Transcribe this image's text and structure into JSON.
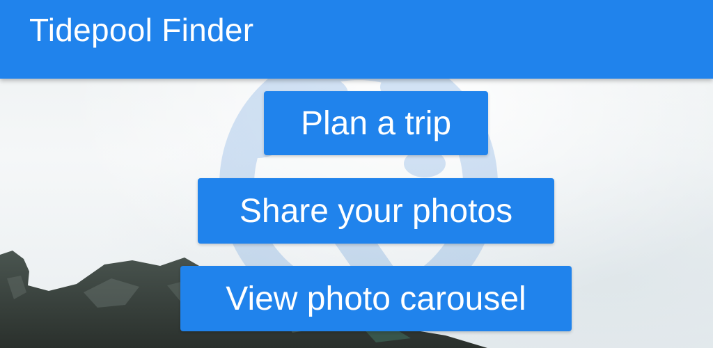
{
  "app": {
    "title": "Tidepool Finder"
  },
  "buttons": {
    "plan_trip": "Plan a trip",
    "share_photos": "Share your photos",
    "view_carousel": "View photo carousel"
  },
  "colors": {
    "primary": "#2083ec",
    "on_primary": "#ffffff",
    "background": "#ecf0f1",
    "rock": "#3b4540"
  }
}
